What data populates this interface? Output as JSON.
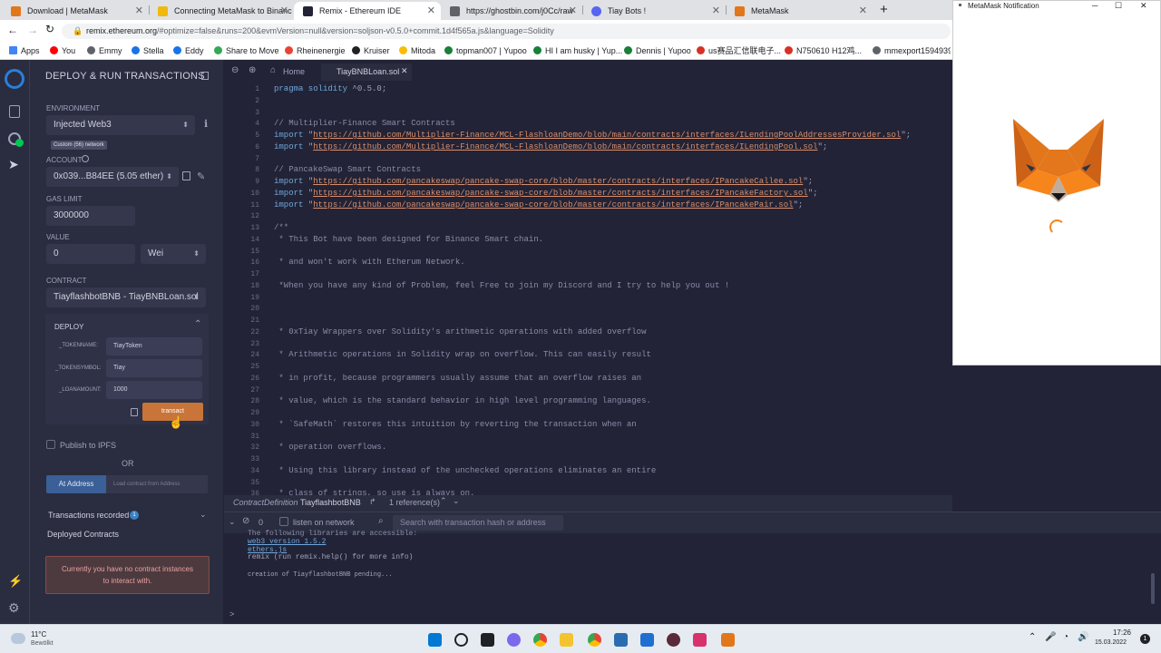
{
  "browser": {
    "tabs": [
      {
        "label": "Download | MetaMask",
        "color": "#e2761b"
      },
      {
        "label": "Connecting MetaMask to Binanc",
        "color": "#f0b90b"
      },
      {
        "label": "Remix - Ethereum IDE",
        "color": "#222336"
      },
      {
        "label": "https://ghostbin.com/j0Cc/raw",
        "color": "#5f6368"
      },
      {
        "label": "Tiay Bots !",
        "color": "#5865f2"
      },
      {
        "label": "MetaMask",
        "color": "#e2761b"
      }
    ],
    "url_host": "remix.ethereum.org",
    "url_rest": "/#optimize=false&runs=200&evmVersion=null&version=soljson-v0.5.0+commit.1d4f565a.js&language=Solidity",
    "bookmarks": [
      "Apps",
      "You",
      "Emmy",
      "Stella",
      "Eddy",
      "Share to Move",
      "Rheinenergie",
      "Kruiser",
      "Mitoda",
      "topman007 | Yupoo",
      "HI I am husky | Yup...",
      "Dennis | Yupoo",
      "us赛品汇信联电子...",
      "N750610 H12鸡...",
      "mmexport1594939..."
    ]
  },
  "side": {
    "title": "DEPLOY & RUN TRANSACTIONS",
    "environment_label": "ENVIRONMENT",
    "environment_value": "Injected Web3",
    "network_badge": "Custom (56) network",
    "account_label": "ACCOUNT",
    "account_value": "0x039...B84EE (5.05 ether)",
    "gas_label": "GAS LIMIT",
    "gas_value": "3000000",
    "value_label": "VALUE",
    "value_amount": "0",
    "value_unit": "Wei",
    "contract_label": "CONTRACT",
    "contract_value": "TiayflashbotBNB - TiayBNBLoan.sol",
    "deploy_label": "DEPLOY",
    "params": [
      {
        "name": "_TOKENNAME:",
        "value": "TiayToken"
      },
      {
        "name": "_TOKENSYMBOL:",
        "value": "Tiay"
      },
      {
        "name": "_LOANAMOUNT:",
        "value": "1000"
      }
    ],
    "transact_label": "transact",
    "publish_label": "Publish to IPFS",
    "or_label": "OR",
    "at_address_label": "At Address",
    "load_placeholder": "Load contract from Address",
    "tx_recorded_label": "Transactions recorded",
    "tx_count": "1",
    "deployed_label": "Deployed Contracts",
    "no_contracts_msg": "Currently you have no contract instances to interact with."
  },
  "editor": {
    "home_tab": "Home",
    "file_tab": "TiayBNBLoan.sol",
    "lines": [
      "pragma solidity ^0.5.0;",
      "",
      "",
      "// Multiplier-Finance Smart Contracts",
      "import \"https://github.com/Multiplier-Finance/MCL-FlashloanDemo/blob/main/contracts/interfaces/ILendingPoolAddressesProvider.sol\";",
      "import \"https://github.com/Multiplier-Finance/MCL-FlashloanDemo/blob/main/contracts/interfaces/ILendingPool.sol\";",
      "",
      "// PancakeSwap Smart Contracts",
      "import \"https://github.com/pancakeswap/pancake-swap-core/blob/master/contracts/interfaces/IPancakeCallee.sol\";",
      "import \"https://github.com/pancakeswap/pancake-swap-core/blob/master/contracts/interfaces/IPancakeFactory.sol\";",
      "import \"https://github.com/pancakeswap/pancake-swap-core/blob/master/contracts/interfaces/IPancakePair.sol\";",
      "",
      "/**",
      " * This Bot have been designed for Binance Smart chain.",
      "",
      " * and won't work with Etherum Network.",
      "",
      " *When you have any kind of Problem, feel Free to join my Discord and I try to help you out !",
      "",
      "",
      "",
      " * 0xTiay Wrappers over Solidity's arithmetic operations with added overflow",
      "",
      " * Arithmetic operations in Solidity wrap on overflow. This can easily result",
      "",
      " * in profit, because programmers usually assume that an overflow raises an",
      "",
      " * value, which is the standard behavior in high level programming languages.",
      "",
      " * `SafeMath` restores this intuition by reverting the transaction when an",
      "",
      " * operation overflows.",
      "",
      " * Using this library instead of the unchecked operations eliminates an entire",
      "",
      " * class of strings, so use is always on."
    ],
    "status_def": "ContractDefinition",
    "status_name": "TiayflashbotBNB",
    "status_refs": "1 reference(s)"
  },
  "terminal": {
    "count": "0",
    "listen_label": "listen on network",
    "search_placeholder": "Search with transaction hash or address",
    "lines": [
      "The following libraries are accessible:",
      "web3 version 1.5.2",
      "ethers.js",
      "remix (run remix.help() for more info)",
      "",
      "creation of TiayflashbotBNB pending..."
    ],
    "prompt": ">"
  },
  "metamask": {
    "title": "MetaMask Notification"
  },
  "taskbar": {
    "temp": "11°C",
    "weather": "Bewölkt",
    "time": "17:26",
    "date": "15.03.2022",
    "notif": "1"
  }
}
